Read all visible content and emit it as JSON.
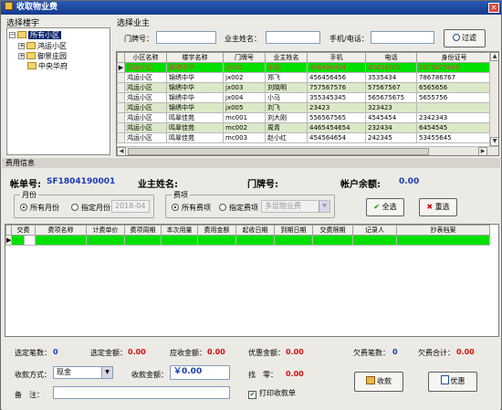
{
  "window": {
    "title": "收取物业费"
  },
  "tree_panel": {
    "title": "选择楼宇",
    "nodes": [
      {
        "label": "所有小区",
        "selected": true
      },
      {
        "label": "鸿运小区"
      },
      {
        "label": "御景庄园"
      },
      {
        "label": "中央华府"
      }
    ]
  },
  "owner_panel": {
    "title": "选择业主",
    "door_label": "门牌号：",
    "name_label": "业主姓名：",
    "phone_label": "手机/电话：",
    "filter_button": "过滤",
    "columns": [
      "小区名称",
      "楼宇名称",
      "门牌号",
      "业主姓名",
      "手机",
      "电话",
      "身份证号"
    ],
    "rows": [
      [
        "鸿运小区",
        "锦绣中华",
        "jx001",
        "小超",
        "456456454",
        "45454565",
        "5675675645"
      ],
      [
        "鸿运小区",
        "锦绣中华",
        "jx002",
        "郑飞",
        "456456456",
        "3535434",
        "786786767"
      ],
      [
        "鸿运小区",
        "锦绣中华",
        "jx003",
        "刘晓明",
        "757567576",
        "57567567",
        "6565656"
      ],
      [
        "鸿运小区",
        "锦绣中华",
        "jx004",
        "小马",
        "355345345",
        "565675675",
        "5655756"
      ],
      [
        "鸿运小区",
        "锦绣中华",
        "jx005",
        "刘飞",
        "23423",
        "323423",
        ""
      ],
      [
        "鸿运小区",
        "鸣翠佳苑",
        "mc001",
        "刘大刚",
        "556567565",
        "4545454",
        "2342343"
      ],
      [
        "鸿运小区",
        "鸣翠佳苑",
        "mc002",
        "周青",
        "4465454654",
        "232434",
        "6454545"
      ],
      [
        "鸿运小区",
        "鸣翠佳苑",
        "mc003",
        "赵小红",
        "454564654",
        "242345",
        "53455645"
      ]
    ]
  },
  "fee_info": {
    "section_title": "费用信息",
    "account_label": "帐单号:",
    "account_no": "SF1804190001",
    "owner_label": "业主姓名:",
    "door_label": "门牌号:",
    "balance_label": "帐户余额:",
    "balance_value": "0.00",
    "month_group": "月份",
    "all_months": "所有月份",
    "specific_month": "指定月份",
    "month_value": "2018-04",
    "fee_group": "费项",
    "all_fees": "所有费项",
    "specific_fee": "指定费项",
    "fee_value": "多层物业费",
    "select_all": "全选",
    "reselect": "重选",
    "columns": [
      "交费",
      "费项名称",
      "计费单价",
      "费项周期",
      "本次用量",
      "费用金额",
      "起收日期",
      "到期日期",
      "交费限期",
      "记录人",
      "抄表档案"
    ]
  },
  "summary": {
    "sel_count_label": "选定笔数：",
    "sel_count": "0",
    "sel_amount_label": "选定金额：",
    "sel_amount": "0.00",
    "due_amount_label": "应收金额：",
    "due_amount": "0.00",
    "discount_label": "优惠金额：",
    "discount": "0.00",
    "arrears_count_label": "欠费笔数：",
    "arrears_count": "0",
    "arrears_total_label": "欠费合计：",
    "arrears_total": "0.00",
    "pay_method_label": "收款方式：",
    "pay_method": "现金",
    "received_label": "收款金额：",
    "received": "￥0.00",
    "change_label": "找　零：",
    "change": "0.00",
    "remark_label": "备　注：",
    "print_receipt": "打印收款单",
    "collect_button": "收款",
    "discount_button": "优惠"
  }
}
